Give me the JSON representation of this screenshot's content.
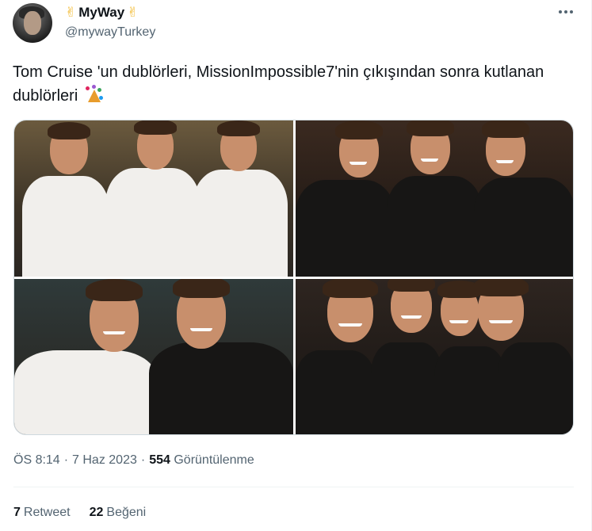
{
  "author": {
    "name": "MyWay",
    "name_emoji_left": "✌",
    "name_emoji_right": "✌",
    "handle": "@mywayTurkey"
  },
  "tweet": {
    "text": "Tom Cruise 'un dublörleri, MissionImpossible7'nin çıkışından sonra kutlanan dublörleri",
    "emoji_name": "party-popper-icon"
  },
  "photos": [
    {
      "name": "photo-1"
    },
    {
      "name": "photo-2"
    },
    {
      "name": "photo-3"
    },
    {
      "name": "photo-4"
    }
  ],
  "meta": {
    "time": "ÖS 8:14",
    "sep1": "·",
    "date": "7 Haz 2023",
    "sep2": "·",
    "views_count": "554",
    "views_label": "Görüntülenme"
  },
  "stats": {
    "retweets_count": "7",
    "retweets_label": "Retweet",
    "likes_count": "22",
    "likes_label": "Beğeni"
  },
  "colors": {
    "text": "#0f1419",
    "secondary": "#536471",
    "border": "#cfd9de"
  }
}
